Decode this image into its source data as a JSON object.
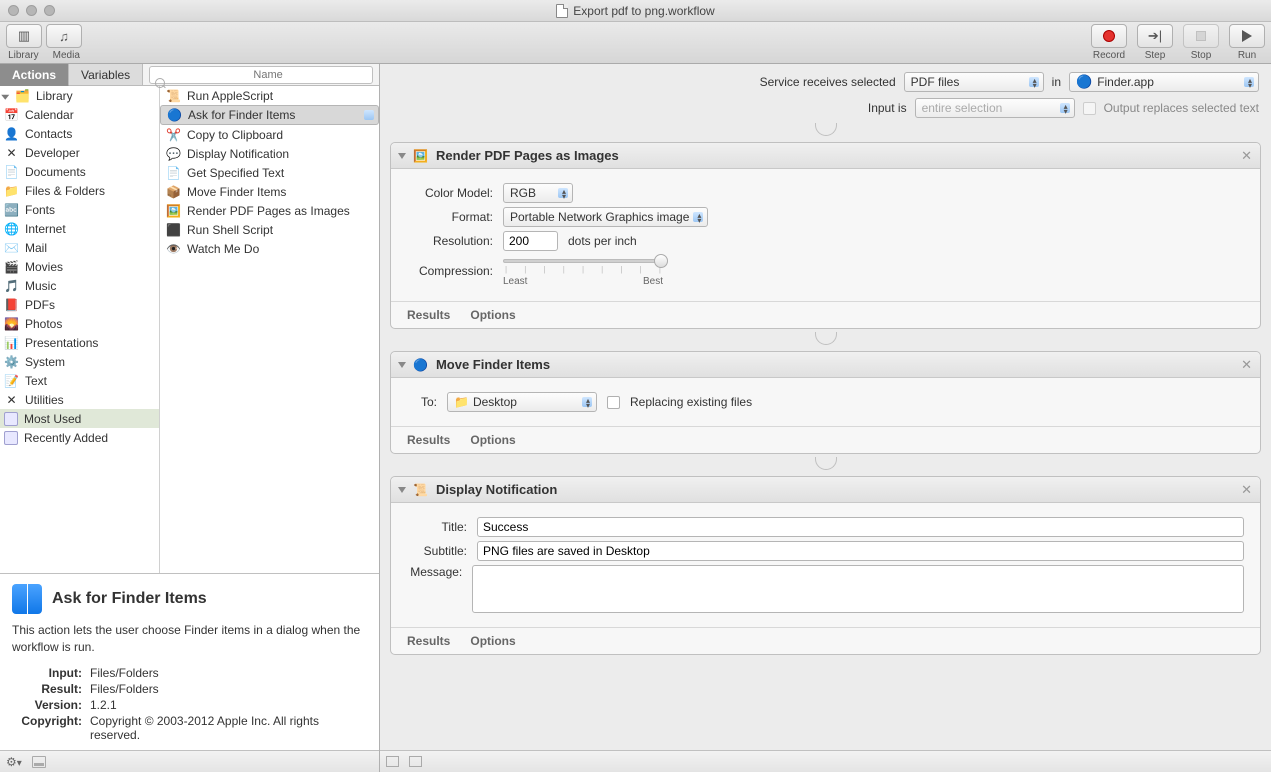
{
  "window": {
    "title": "Export pdf to png.workflow"
  },
  "toolbar": {
    "left": [
      {
        "name": "library-toggle",
        "label": "Library",
        "icon": "▥"
      },
      {
        "name": "media-toggle",
        "label": "Media",
        "icon": "♪"
      }
    ],
    "right": [
      {
        "name": "record-button",
        "label": "Record"
      },
      {
        "name": "step-button",
        "label": "Step",
        "icon": "➔|"
      },
      {
        "name": "stop-button",
        "label": "Stop"
      },
      {
        "name": "run-button",
        "label": "Run"
      }
    ]
  },
  "tabs": {
    "actions": "Actions",
    "variables": "Variables",
    "search_placeholder": "Name"
  },
  "categories": {
    "root": "Library",
    "items": [
      {
        "icon": "📅",
        "label": "Calendar"
      },
      {
        "icon": "👤",
        "label": "Contacts"
      },
      {
        "icon": "✕",
        "label": "Developer"
      },
      {
        "icon": "📄",
        "label": "Documents"
      },
      {
        "icon": "📁",
        "label": "Files & Folders"
      },
      {
        "icon": "🔤",
        "label": "Fonts"
      },
      {
        "icon": "🌐",
        "label": "Internet"
      },
      {
        "icon": "✉️",
        "label": "Mail"
      },
      {
        "icon": "🎬",
        "label": "Movies"
      },
      {
        "icon": "🎵",
        "label": "Music"
      },
      {
        "icon": "📕",
        "label": "PDFs"
      },
      {
        "icon": "🌄",
        "label": "Photos"
      },
      {
        "icon": "📊",
        "label": "Presentations"
      },
      {
        "icon": "⚙️",
        "label": "System"
      },
      {
        "icon": "📝",
        "label": "Text"
      },
      {
        "icon": "✕",
        "label": "Utilities"
      }
    ],
    "smart": [
      {
        "label": "Most Used"
      },
      {
        "label": "Recently Added"
      }
    ]
  },
  "actions": [
    {
      "icon": "📜",
      "label": "Run AppleScript"
    },
    {
      "icon": "🔵",
      "label": "Ask for Finder Items",
      "selected": true
    },
    {
      "icon": "✂️",
      "label": "Copy to Clipboard"
    },
    {
      "icon": "💬",
      "label": "Display Notification"
    },
    {
      "icon": "📄",
      "label": "Get Specified Text"
    },
    {
      "icon": "📦",
      "label": "Move Finder Items"
    },
    {
      "icon": "🖼️",
      "label": "Render PDF Pages as Images"
    },
    {
      "icon": "⬛",
      "label": "Run Shell Script"
    },
    {
      "icon": "👁️",
      "label": "Watch Me Do"
    }
  ],
  "description": {
    "title": "Ask for Finder Items",
    "body": "This action lets the user choose Finder items in a dialog when the workflow is run.",
    "meta": {
      "input_k": "Input:",
      "input_v": "Files/Folders",
      "result_k": "Result:",
      "result_v": "Files/Folders",
      "version_k": "Version:",
      "version_v": "1.2.1",
      "copyright_k": "Copyright:",
      "copyright_v": "Copyright © 2003-2012 Apple Inc.  All rights reserved."
    }
  },
  "workflow_header": {
    "receives_label": "Service receives selected",
    "receives_value": "PDF files",
    "in_label": "in",
    "app_value": "Finder.app",
    "input_label": "Input is",
    "input_value": "entire selection",
    "replace_label": "Output replaces selected text"
  },
  "steps": {
    "results": "Results",
    "options": "Options",
    "s1": {
      "title": "Render PDF Pages as Images",
      "color_label": "Color Model:",
      "color_value": "RGB",
      "format_label": "Format:",
      "format_value": "Portable Network Graphics image",
      "resolution_label": "Resolution:",
      "resolution_value": "200",
      "resolution_unit": "dots per inch",
      "compression_label": "Compression:",
      "least": "Least",
      "best": "Best"
    },
    "s2": {
      "title": "Move Finder Items",
      "to_label": "To:",
      "to_value": "Desktop",
      "replace_label": "Replacing existing files"
    },
    "s3": {
      "title": "Display Notification",
      "title_label": "Title:",
      "title_value": "Success",
      "subtitle_label": "Subtitle:",
      "subtitle_value": "PNG files are saved in Desktop",
      "message_label": "Message:"
    }
  }
}
